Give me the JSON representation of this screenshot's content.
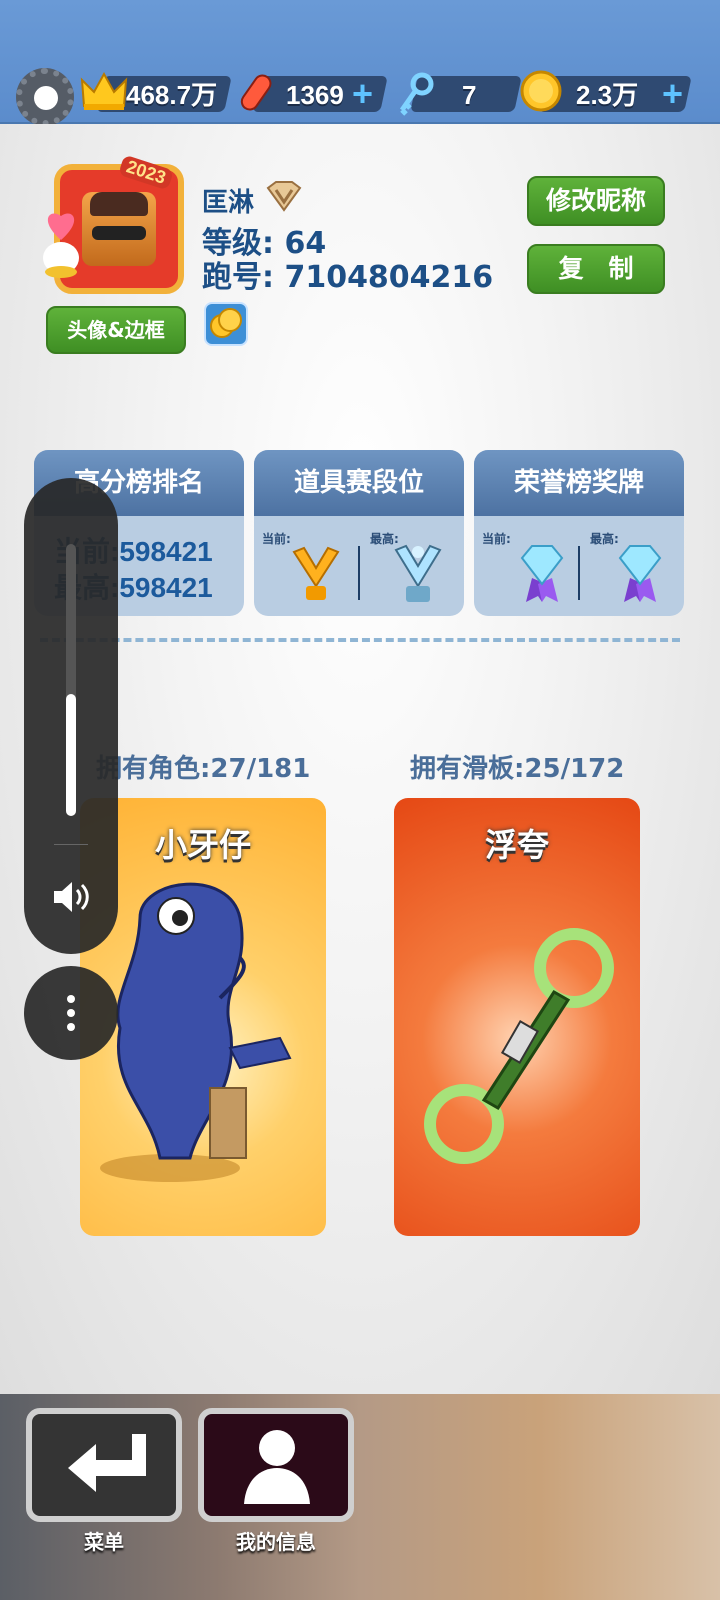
{
  "resources": {
    "crowns": "468.7万",
    "boards": "1369",
    "keys": "7",
    "coins": "2.3万"
  },
  "profile": {
    "avatar_year": "2023",
    "name": "匡淋",
    "level": "等级: 64",
    "runner_id": "跑号: 7104804216",
    "edit_nickname": "修改昵称",
    "copy": "复　制",
    "avatar_frame_button": "头像&边框"
  },
  "cards": [
    {
      "title": "高分榜排名",
      "current": "当前:598421",
      "best": "最高:598421"
    },
    {
      "title": "道具赛段位",
      "current_label": "当前:",
      "best_label": "最高:"
    },
    {
      "title": "荣誉榜奖牌",
      "current_label": "当前:",
      "best_label": "最高:"
    }
  ],
  "collection": {
    "characters_owned": "拥有角色:27/181",
    "boards_owned": "拥有滑板:25/172",
    "character_name": "小牙仔",
    "board_name": "浮夸"
  },
  "volume": {
    "level": 0.45
  },
  "bottom_nav": {
    "menu": "菜单",
    "my_info": "我的信息"
  },
  "colors": {
    "top_bar": "#5b8ccc",
    "green_button": "#4a9d2c",
    "card_header": "#5a80b0",
    "character_bg": "#ffb234",
    "board_bg": "#e54814"
  }
}
